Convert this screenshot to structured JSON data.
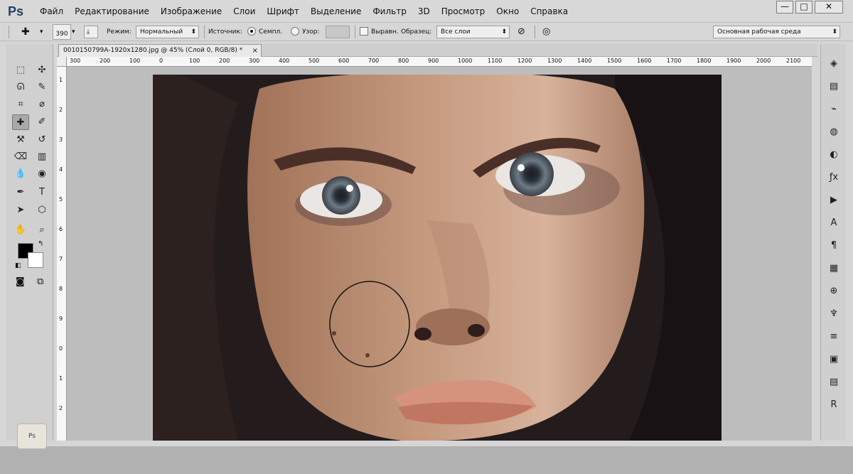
{
  "app": {
    "logo": "Ps"
  },
  "menu": [
    "Файл",
    "Редактирование",
    "Изображение",
    "Слои",
    "Шрифт",
    "Выделение",
    "Фильтр",
    "3D",
    "Просмотр",
    "Окно",
    "Справка"
  ],
  "window_controls": {
    "minimize": "—",
    "maximize": "□",
    "close": "✕"
  },
  "options": {
    "brush_size": "390",
    "mode_label": "Режим:",
    "mode_value": "Нормальный",
    "source_label": "Источник:",
    "sampled": "Семпл.",
    "pattern": "Узор:",
    "aligned": "Выравн.",
    "sample_label": "Образец:",
    "sample_value": "Все слои",
    "workspace": "Основная рабочая среда"
  },
  "document": {
    "tab": "0010150799A-1920x1280.jpg @ 45% (Слой 0, RGB/8) *",
    "close": "×"
  },
  "ruler_top": [
    "300",
    "200",
    "100",
    "0",
    "100",
    "200",
    "300",
    "400",
    "500",
    "600",
    "700",
    "800",
    "900",
    "1000",
    "1100",
    "1200",
    "1300",
    "1400",
    "1500",
    "1600",
    "1700",
    "1800",
    "1900",
    "2000",
    "2100"
  ],
  "ruler_left": [
    "1",
    "2",
    "3",
    "4",
    "5",
    "6",
    "7",
    "8",
    "9",
    "0",
    "1",
    "2"
  ],
  "tools": [
    {
      "name": "marquee",
      "glyph": "⬚"
    },
    {
      "name": "move",
      "glyph": "✣"
    },
    {
      "name": "lasso",
      "glyph": "ᘏ"
    },
    {
      "name": "quick-selection",
      "glyph": "✎"
    },
    {
      "name": "crop",
      "glyph": "⌗"
    },
    {
      "name": "eyedropper",
      "glyph": "⌀"
    },
    {
      "name": "healing-brush",
      "glyph": "✚"
    },
    {
      "name": "brush",
      "glyph": "✐"
    },
    {
      "name": "clone-stamp",
      "glyph": "⚒"
    },
    {
      "name": "history-brush",
      "glyph": "↺"
    },
    {
      "name": "eraser",
      "glyph": "⌫"
    },
    {
      "name": "gradient",
      "glyph": "▥"
    },
    {
      "name": "blur",
      "glyph": "💧"
    },
    {
      "name": "dodge",
      "glyph": "◉"
    },
    {
      "name": "pen",
      "glyph": "✒"
    },
    {
      "name": "type",
      "glyph": "T"
    },
    {
      "name": "path-selection",
      "glyph": "➤"
    },
    {
      "name": "shape",
      "glyph": "⬡"
    },
    {
      "name": "hand",
      "glyph": "✋"
    },
    {
      "name": "zoom",
      "glyph": "⌕"
    }
  ],
  "panel_icons": [
    "layers",
    "channels",
    "paths",
    "3d",
    "adjustments",
    "styles",
    "actions",
    "character",
    "paragraph",
    "swatches",
    "navigator",
    "brush",
    "properties",
    "history",
    "notes",
    "logo"
  ],
  "panel_glyphs": [
    "◈",
    "▤",
    "⌁",
    "◍",
    "◐",
    "ƒx",
    "▶",
    "A",
    "¶",
    "▦",
    "⊕",
    "♆",
    "≡",
    "▣",
    "▤",
    "R"
  ],
  "mascot": {
    "text": "Ps"
  }
}
